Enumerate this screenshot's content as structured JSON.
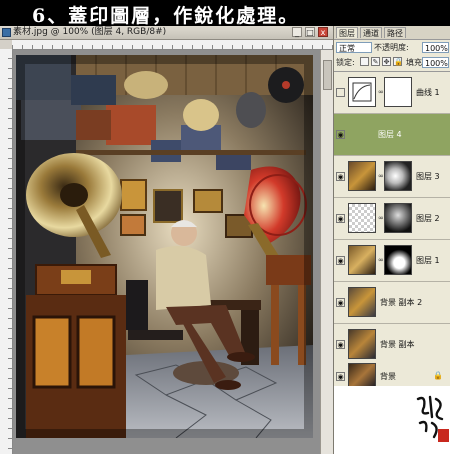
{
  "banner": {
    "text": "6、蓋印圖層，作銳化處理。"
  },
  "document": {
    "title": "素材.jpg @ 100% (图层 4, RGB/8#)",
    "window_buttons": {
      "minimize": "_",
      "maximize": "□",
      "close": "x"
    }
  },
  "layers_panel": {
    "tabs": [
      "图层",
      "通道",
      "路径"
    ],
    "blend_mode": "正常",
    "opacity_label": "不透明度:",
    "opacity_value": "100%",
    "lock_label": "锁定:",
    "fill_label": "填充:",
    "fill_value": "100%",
    "layers": [
      {
        "name": "曲线 1",
        "type": "adjustment",
        "visible": false,
        "selected": false
      },
      {
        "name": "图层 4",
        "type": "pixel",
        "visible": true,
        "selected": true
      },
      {
        "name": "图层 3",
        "type": "masked",
        "visible": true,
        "selected": false
      },
      {
        "name": "图层 2",
        "type": "masked",
        "visible": true,
        "selected": false
      },
      {
        "name": "图层 1",
        "type": "masked",
        "visible": true,
        "selected": false
      },
      {
        "name": "背景 副本 2",
        "type": "pixel",
        "visible": true,
        "selected": false
      },
      {
        "name": "背景 副本",
        "type": "pixel",
        "visible": true,
        "selected": false
      },
      {
        "name": "背景",
        "type": "background",
        "visible": true,
        "selected": false,
        "locked": true
      }
    ],
    "selected_color": "#8fa461"
  }
}
